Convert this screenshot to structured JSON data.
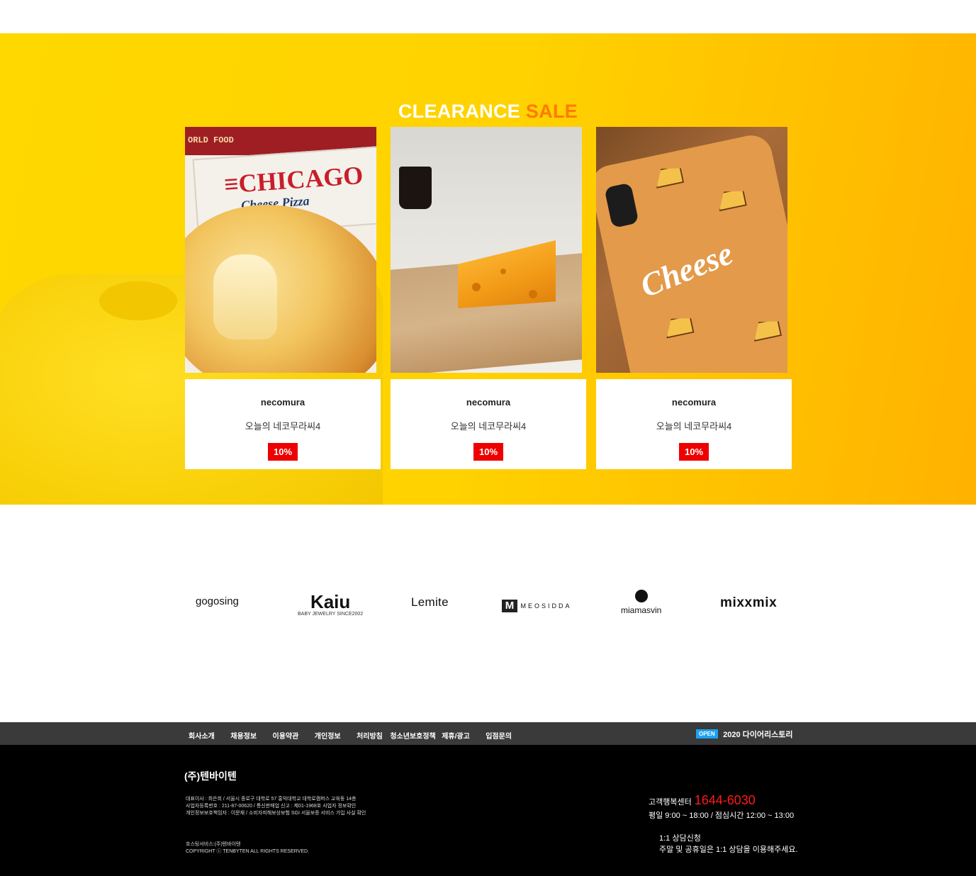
{
  "clearance": {
    "title_main": "CLEARANCE ",
    "title_accent": "SALE",
    "colors": {
      "accent": "#ff7a00",
      "discount_badge": "#ee0000",
      "background": "#ffd200"
    },
    "products": [
      {
        "brand": "necomura",
        "name": "오늘의 네코무라씨4",
        "discount": "10%",
        "image": {
          "icon": "pizza-image",
          "band_text": "ORLD FOOD",
          "title": "≡CHICAGO",
          "subtitle": "Cheese Pizza"
        }
      },
      {
        "brand": "necomura",
        "name": "오늘의 네코무라씨4",
        "discount": "10%",
        "image": {
          "icon": "cheese-candle-image"
        }
      },
      {
        "brand": "necomura",
        "name": "오늘의 네코무라씨4",
        "discount": "10%",
        "image": {
          "icon": "cheese-phone-case-image",
          "word": "Cheese"
        }
      }
    ]
  },
  "brands": {
    "gogosing": "gogosing",
    "kaiu": "Kaiu",
    "kaiu_tagline": "BABY JEWELRY SINCE2002",
    "lemite": "Lemite",
    "meosidda": "MEOSIDDA",
    "miamasvin": "miamasvin",
    "mixxmix": "mixxmix"
  },
  "footer_nav": {
    "links": [
      "회사소개",
      "채용정보",
      "이용약관",
      "개인정보",
      "처리방침",
      "청소년보호정책",
      "제휴/광고",
      "입점문의"
    ],
    "open_badge": "OPEN",
    "open_text": "2020 다이어리스토리",
    "badge_color": "#1da1f2"
  },
  "footer": {
    "company": "(주)텐바이텐",
    "biz_line1": "대표이사 : 최은희 / 서울시 종로구 대학로 57 홍익대학교 대학로캠퍼스 교육동 14층",
    "biz_line2": "사업자등록번호 : 211-87-00620 / 통신판매업 신고 : 제01-1968호 사업자 정보확인",
    "biz_line3": "개인정보보호책임자 : 이문재 / 소비자피해보상보험 SGI 서울보증 서비스 가입 사실 확인",
    "hosting": "호스팅서비스:(주)텐바이텐",
    "copyright": "COPYRIGHT ⓒ TENBYTEN ALL RIGHTS RESERVED.",
    "cs_label": "고객행복센터",
    "cs_phone": "1644-6030",
    "cs_hours": "평일 9:00 ~ 18:00 / 점심시간 12:00 ~ 13:00",
    "qna_label": "1:1 상담신청",
    "qna_note": "주말 및 공휴일은 1:1 상담을 이용해주세요.",
    "phone_color": "#ff1a1a"
  }
}
